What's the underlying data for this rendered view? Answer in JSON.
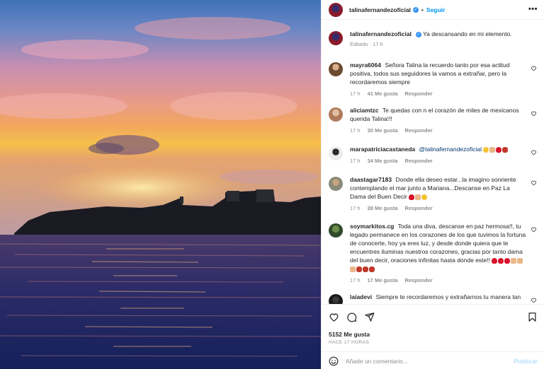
{
  "post": {
    "author": "talinafernandezoficial",
    "follow_label": "Seguir",
    "more_label": "•••",
    "caption": "Ya descansando en mi elemento.",
    "caption_meta": "Editado · 17 h"
  },
  "comments": [
    {
      "user": "mayra6064",
      "text": "Señora Talina la recuerdo tanto por esa actitud positiva, todos sus seguidores la vamos a extrañar, pero la recordaremos siempre",
      "time": "17 h",
      "likes": "41 Me gusta",
      "reply": "Responder"
    },
    {
      "user": "aliciamtzc",
      "text": "Te quedas con n el corazón de miles de mexicanos querida Talina!!!",
      "time": "17 h",
      "likes": "30 Me gusta",
      "reply": "Responder"
    },
    {
      "user": "marapatriciacastaneda",
      "mention": "@talinafernandezoficial",
      "time": "17 h",
      "likes": "34 Me gusta",
      "reply": "Responder"
    },
    {
      "user": "daastagar7183",
      "text": "Donde ella deseo estar...la imagino sonriente contemplando el mar junto a Mariana...Descanse en Paz La Dama del Buen Decir",
      "time": "17 h",
      "likes": "28 Me gusta",
      "reply": "Responder"
    },
    {
      "user": "soymarkitos.cg",
      "text": "Toda una diva, descanse en paz hermosa!!, tu legado permanece en los corazones de los que tuvimos la fortuna de conocerte, hoy ya eres luz, y desde donde quiera que te encuentres iluminas nuestros corazones, gracias por tanto dama del buen decir, oraciones infinitas hasta donde este!!",
      "time": "17 h",
      "likes": "17 Me gusta",
      "reply": "Responder"
    },
    {
      "user": "laiadevi",
      "text": "Siempre te recordaremos y extrañarnos tu manera tan"
    }
  ],
  "footer": {
    "likes_count": "5152 Me gusta",
    "posted_ago": "HACE 17 HORAS",
    "comment_placeholder": "Añade un comentario...",
    "publish_label": "Publicar"
  },
  "icons": [
    "like-icon",
    "comment-icon",
    "share-icon",
    "save-icon",
    "emoji-icon",
    "verified-icon",
    "heart-small-icon"
  ],
  "colors": {
    "link": "#0095f6",
    "verified": "#3897f0",
    "mention": "#00376b",
    "muted": "#8e8e8e"
  }
}
